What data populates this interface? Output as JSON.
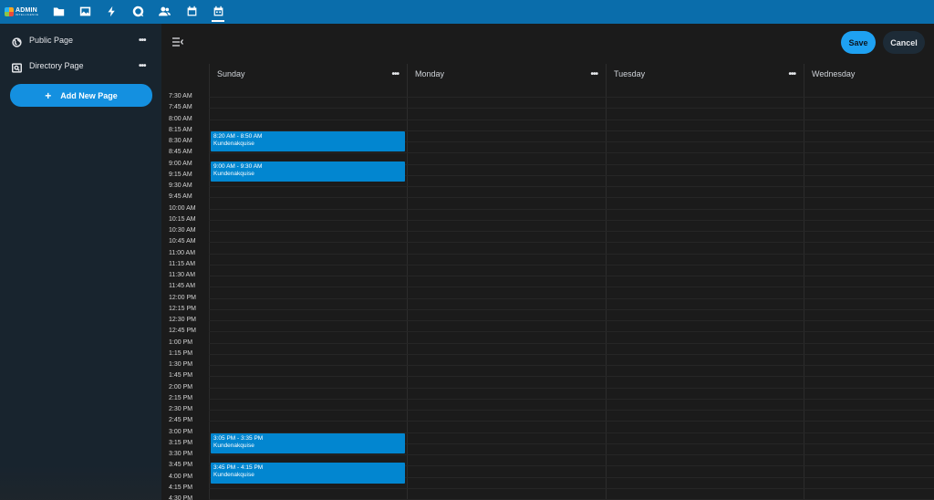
{
  "topbar": {
    "logo_line1": "ADMIN",
    "logo_line2": "INTELLIGENCE",
    "icons": [
      "folder-icon",
      "image-icon",
      "bolt-icon",
      "chat-icon",
      "users-icon",
      "calendar-icon",
      "calendar-active-icon"
    ]
  },
  "sidebar": {
    "items": [
      {
        "label": "Public Page",
        "icon": "globe-icon",
        "menu": "•••"
      },
      {
        "label": "Directory Page",
        "icon": "directory-search-icon",
        "menu": "•••"
      }
    ],
    "add_button": "Add New Page"
  },
  "toolbar": {
    "save_label": "Save",
    "cancel_label": "Cancel"
  },
  "calendar": {
    "days": [
      {
        "name": "Sunday",
        "menu": "•••"
      },
      {
        "name": "Monday",
        "menu": "•••"
      },
      {
        "name": "Tuesday",
        "menu": "•••"
      },
      {
        "name": "Wednesday",
        "menu": ""
      }
    ],
    "times": [
      "7:30 AM",
      "7:45 AM",
      "8:00 AM",
      "8:15 AM",
      "8:30 AM",
      "8:45 AM",
      "9:00 AM",
      "9:15 AM",
      "9:30 AM",
      "9:45 AM",
      "10:00 AM",
      "10:15 AM",
      "10:30 AM",
      "10:45 AM",
      "11:00 AM",
      "11:15 AM",
      "11:30 AM",
      "11:45 AM",
      "12:00 PM",
      "12:15 PM",
      "12:30 PM",
      "12:45 PM",
      "1:00 PM",
      "1:15 PM",
      "1:30 PM",
      "1:45 PM",
      "2:00 PM",
      "2:15 PM",
      "2:30 PM",
      "2:45 PM",
      "3:00 PM",
      "3:15 PM",
      "3:30 PM",
      "3:45 PM",
      "4:00 PM",
      "4:15 PM",
      "4:30 PM"
    ],
    "events": [
      {
        "day": "Sunday",
        "time": "8:20 AM - 8:50 AM",
        "title": "Kundenakquise"
      },
      {
        "day": "Sunday",
        "time": "9:00 AM - 9:30 AM",
        "title": "Kundenakquise"
      },
      {
        "day": "Sunday",
        "time": "3:05 PM - 3:35 PM",
        "title": "Kundenakquise"
      },
      {
        "day": "Sunday",
        "time": "3:45 PM - 4:15 PM",
        "title": "Kundenakquise"
      }
    ],
    "colors": {
      "event": "#0286d0",
      "topbar": "#0a6dab",
      "accent": "#1ea1f2"
    }
  }
}
